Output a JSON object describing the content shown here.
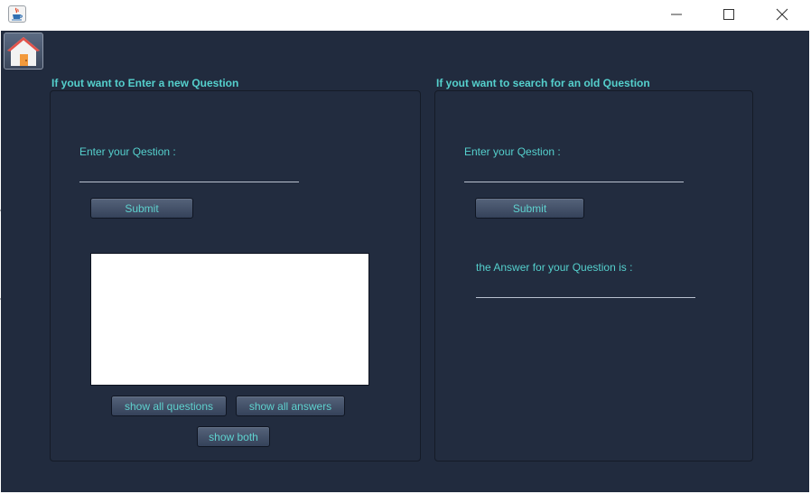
{
  "window": {
    "controls": {
      "minimize": "minimize-icon",
      "maximize": "maximize-icon",
      "close": "close-icon"
    },
    "app_icon": "java-cup-icon"
  },
  "toolbar": {
    "home_icon": "home-icon"
  },
  "new_question": {
    "title": "If yout want to Enter a new Question",
    "prompt_label": "Enter your Qestion :",
    "submit_label": "Submit",
    "output_text": "",
    "show_questions_label": "show all questions",
    "show_answers_label": "show all answers",
    "show_both_label": "show both"
  },
  "search_question": {
    "title": "If yout want to search for an old Question",
    "prompt_label": "Enter your Qestion :",
    "submit_label": "Submit",
    "answer_label": "the Answer for your Question is :"
  },
  "colors": {
    "background": "#212b3e",
    "accent_text": "#55d0cd",
    "button": "#44516a"
  }
}
